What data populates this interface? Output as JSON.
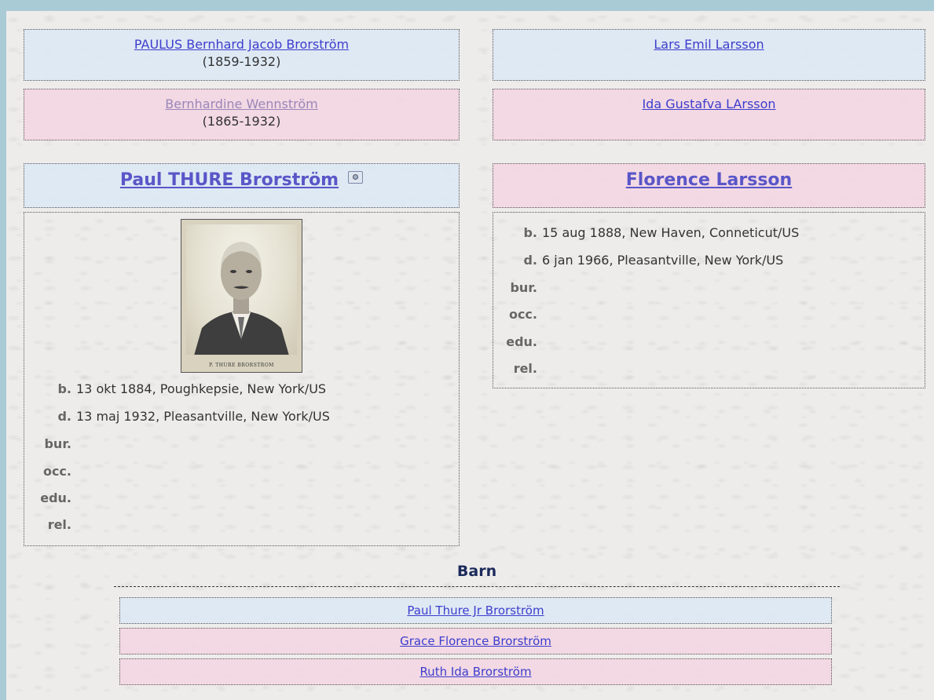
{
  "parents_left": {
    "father": {
      "name": "PAULUS Bernhard Jacob Brorström",
      "years": "(1859-1932)"
    },
    "mother": {
      "name": "Bernhardine Wennström",
      "years": "(1865-1932)"
    }
  },
  "parents_right": {
    "father": {
      "name": "Lars Emil Larsson"
    },
    "mother": {
      "name": "Ida Gustafva LArsson"
    }
  },
  "person1": {
    "name": "Paul THURE Brorström",
    "icon": "camera-icon",
    "photo_caption": "P. THURE BRORSTROM",
    "facts": [
      {
        "label": "b.",
        "value": "13 okt 1884, Poughkepsie, New York/US"
      },
      {
        "label": "d.",
        "value": "13 maj 1932, Pleasantville, New York/US"
      },
      {
        "label": "bur.",
        "value": ""
      },
      {
        "label": "occ.",
        "value": ""
      },
      {
        "label": "edu.",
        "value": ""
      },
      {
        "label": "rel.",
        "value": ""
      }
    ]
  },
  "person2": {
    "name": "Florence Larsson",
    "facts": [
      {
        "label": "b.",
        "value": "15 aug 1888, New Haven, Conneticut/US"
      },
      {
        "label": "d.",
        "value": "6 jan 1966, Pleasantville, New York/US"
      },
      {
        "label": "bur.",
        "value": ""
      },
      {
        "label": "occ.",
        "value": ""
      },
      {
        "label": "edu.",
        "value": ""
      },
      {
        "label": "rel.",
        "value": ""
      }
    ]
  },
  "children": {
    "title": "Barn",
    "items": [
      {
        "name": "Paul Thure Jr Brorström"
      },
      {
        "name": "Grace Florence Brorström"
      },
      {
        "name": "Ruth Ida Brorström"
      }
    ]
  },
  "colors": {
    "male_bg": "#dce8f5",
    "female_bg": "#f4d6e2",
    "link": "#3d3dcc",
    "frame": "#a9cbd6"
  }
}
